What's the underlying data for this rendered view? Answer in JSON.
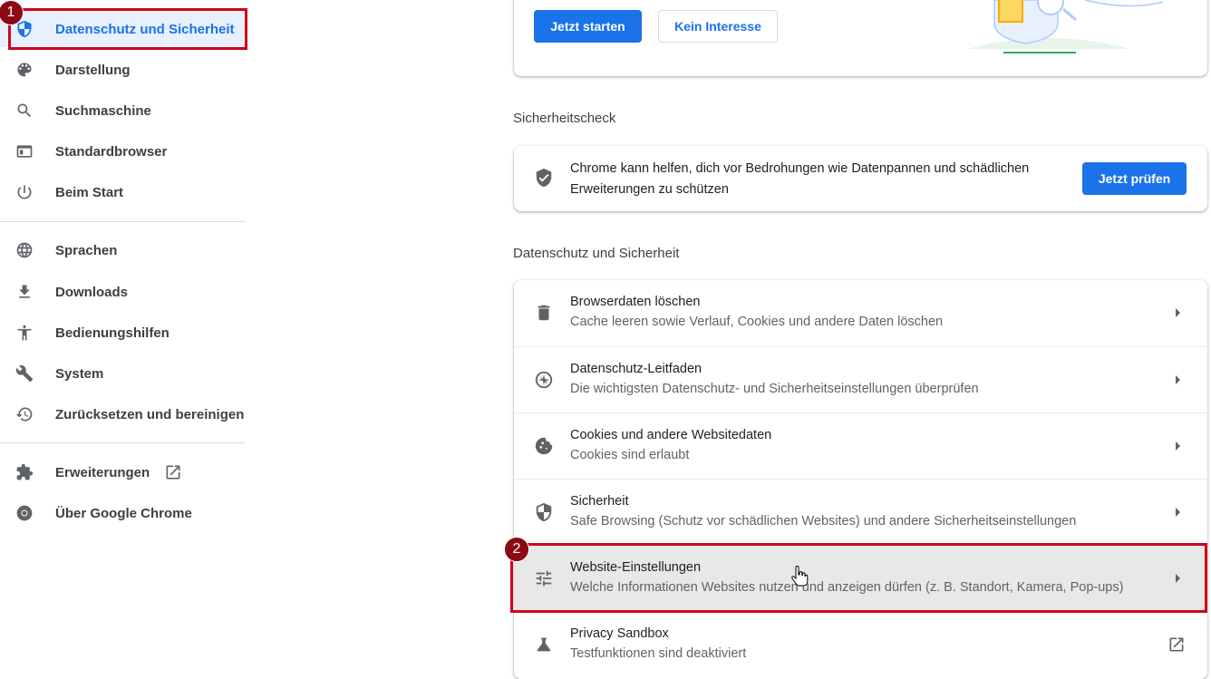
{
  "sidebar": {
    "items": [
      {
        "label": "Datenschutz und Sicherheit",
        "icon": "shield-icon",
        "active": true
      },
      {
        "label": "Darstellung",
        "icon": "palette-icon"
      },
      {
        "label": "Suchmaschine",
        "icon": "search-icon"
      },
      {
        "label": "Standardbrowser",
        "icon": "browser-window-icon"
      },
      {
        "label": "Beim Start",
        "icon": "power-icon"
      },
      {
        "label": "Sprachen",
        "icon": "globe-icon"
      },
      {
        "label": "Downloads",
        "icon": "download-icon"
      },
      {
        "label": "Bedienungshilfen",
        "icon": "accessibility-icon"
      },
      {
        "label": "System",
        "icon": "wrench-icon"
      },
      {
        "label": "Zurücksetzen und bereinigen",
        "icon": "history-icon"
      },
      {
        "label": "Erweiterungen",
        "icon": "puzzle-icon"
      },
      {
        "label": "Über Google Chrome",
        "icon": "chrome-icon"
      }
    ]
  },
  "annotations": {
    "badge1": "1",
    "badge2": "2",
    "color": "#d0021b"
  },
  "top_card": {
    "start_label": "Jetzt starten",
    "no_interest_label": "Kein Interesse"
  },
  "safety_check": {
    "title": "Sicherheitscheck",
    "text": "Chrome kann helfen, dich vor Bedrohungen wie Datenpannen und schädlichen Erweiterungen zu schützen",
    "button_label": "Jetzt prüfen"
  },
  "privacy": {
    "title": "Datenschutz und Sicherheit",
    "rows": [
      {
        "title": "Browserdaten löschen",
        "subtitle": "Cache leeren sowie Verlauf, Cookies und andere Daten löschen",
        "icon": "trash-icon"
      },
      {
        "title": "Datenschutz-Leitfaden",
        "subtitle": "Die wichtigsten Datenschutz- und Sicherheitseinstellungen überprüfen",
        "icon": "compass-icon"
      },
      {
        "title": "Cookies und andere Websitedaten",
        "subtitle": "Cookies sind erlaubt",
        "icon": "cookie-icon"
      },
      {
        "title": "Sicherheit",
        "subtitle": "Safe Browsing (Schutz vor schädlichen Websites) und andere Sicherheitseinstellungen",
        "icon": "shield-icon"
      },
      {
        "title": "Website-Einstellungen",
        "subtitle": "Welche Informationen Websites nutzen und anzeigen dürfen (z. B. Standort, Kamera, Pop-ups)",
        "icon": "tune-icon"
      },
      {
        "title": "Privacy Sandbox",
        "subtitle": "Testfunktionen sind deaktiviert",
        "icon": "flask-icon"
      }
    ]
  },
  "colors": {
    "accent": "#1a73e8",
    "active_bg": "#e8f0fe",
    "hover_row": "#e8e8e8"
  }
}
